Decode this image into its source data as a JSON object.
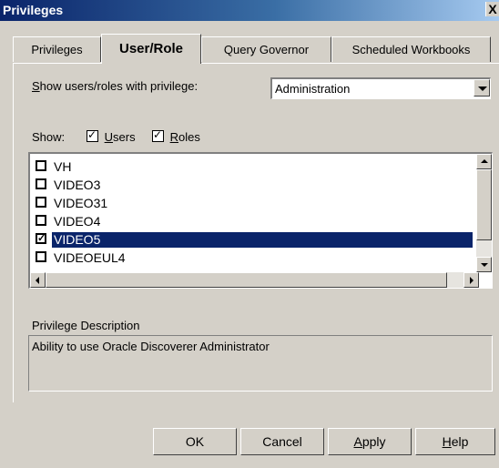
{
  "window": {
    "title": "Privileges",
    "close_glyph": "X"
  },
  "tabs": [
    {
      "label": "Privileges",
      "active": false
    },
    {
      "label": "User/Role",
      "active": true
    },
    {
      "label": "Query Governor",
      "active": false
    },
    {
      "label": "Scheduled Workbooks",
      "active": false
    }
  ],
  "filter": {
    "label_prefix": "S",
    "label_rest": "how users/roles with privilege:",
    "selected_privilege": "Administration"
  },
  "show": {
    "label": "Show:",
    "users": {
      "u": "U",
      "rest": "sers",
      "checked": true
    },
    "roles": {
      "u": "R",
      "rest": "oles",
      "checked": true
    }
  },
  "list": {
    "items": [
      {
        "name": "VH",
        "checked": false,
        "selected": false
      },
      {
        "name": "VIDEO3",
        "checked": false,
        "selected": false
      },
      {
        "name": "VIDEO31",
        "checked": false,
        "selected": false
      },
      {
        "name": "VIDEO4",
        "checked": false,
        "selected": false
      },
      {
        "name": "VIDEO5",
        "checked": true,
        "selected": true
      },
      {
        "name": "VIDEOEUL4",
        "checked": false,
        "selected": false
      }
    ]
  },
  "description": {
    "label": "Privilege Description",
    "text": "Ability to use Oracle Discoverer Administrator"
  },
  "buttons": {
    "ok": "OK",
    "cancel": "Cancel",
    "apply_u": "A",
    "apply_rest": "pply",
    "help_u": "H",
    "help_rest": "elp"
  },
  "check_glyph": "✓",
  "icons": {
    "close": "close-icon",
    "dropdown": "chevron-down-icon",
    "scroll_up": "arrow-up-icon",
    "scroll_down": "arrow-down-icon",
    "scroll_left": "arrow-left-icon",
    "scroll_right": "arrow-right-icon"
  },
  "colors": {
    "title_start": "#0a246a",
    "title_end": "#a6caf0",
    "selection": "#0a246a",
    "face": "#d4d0c8"
  }
}
